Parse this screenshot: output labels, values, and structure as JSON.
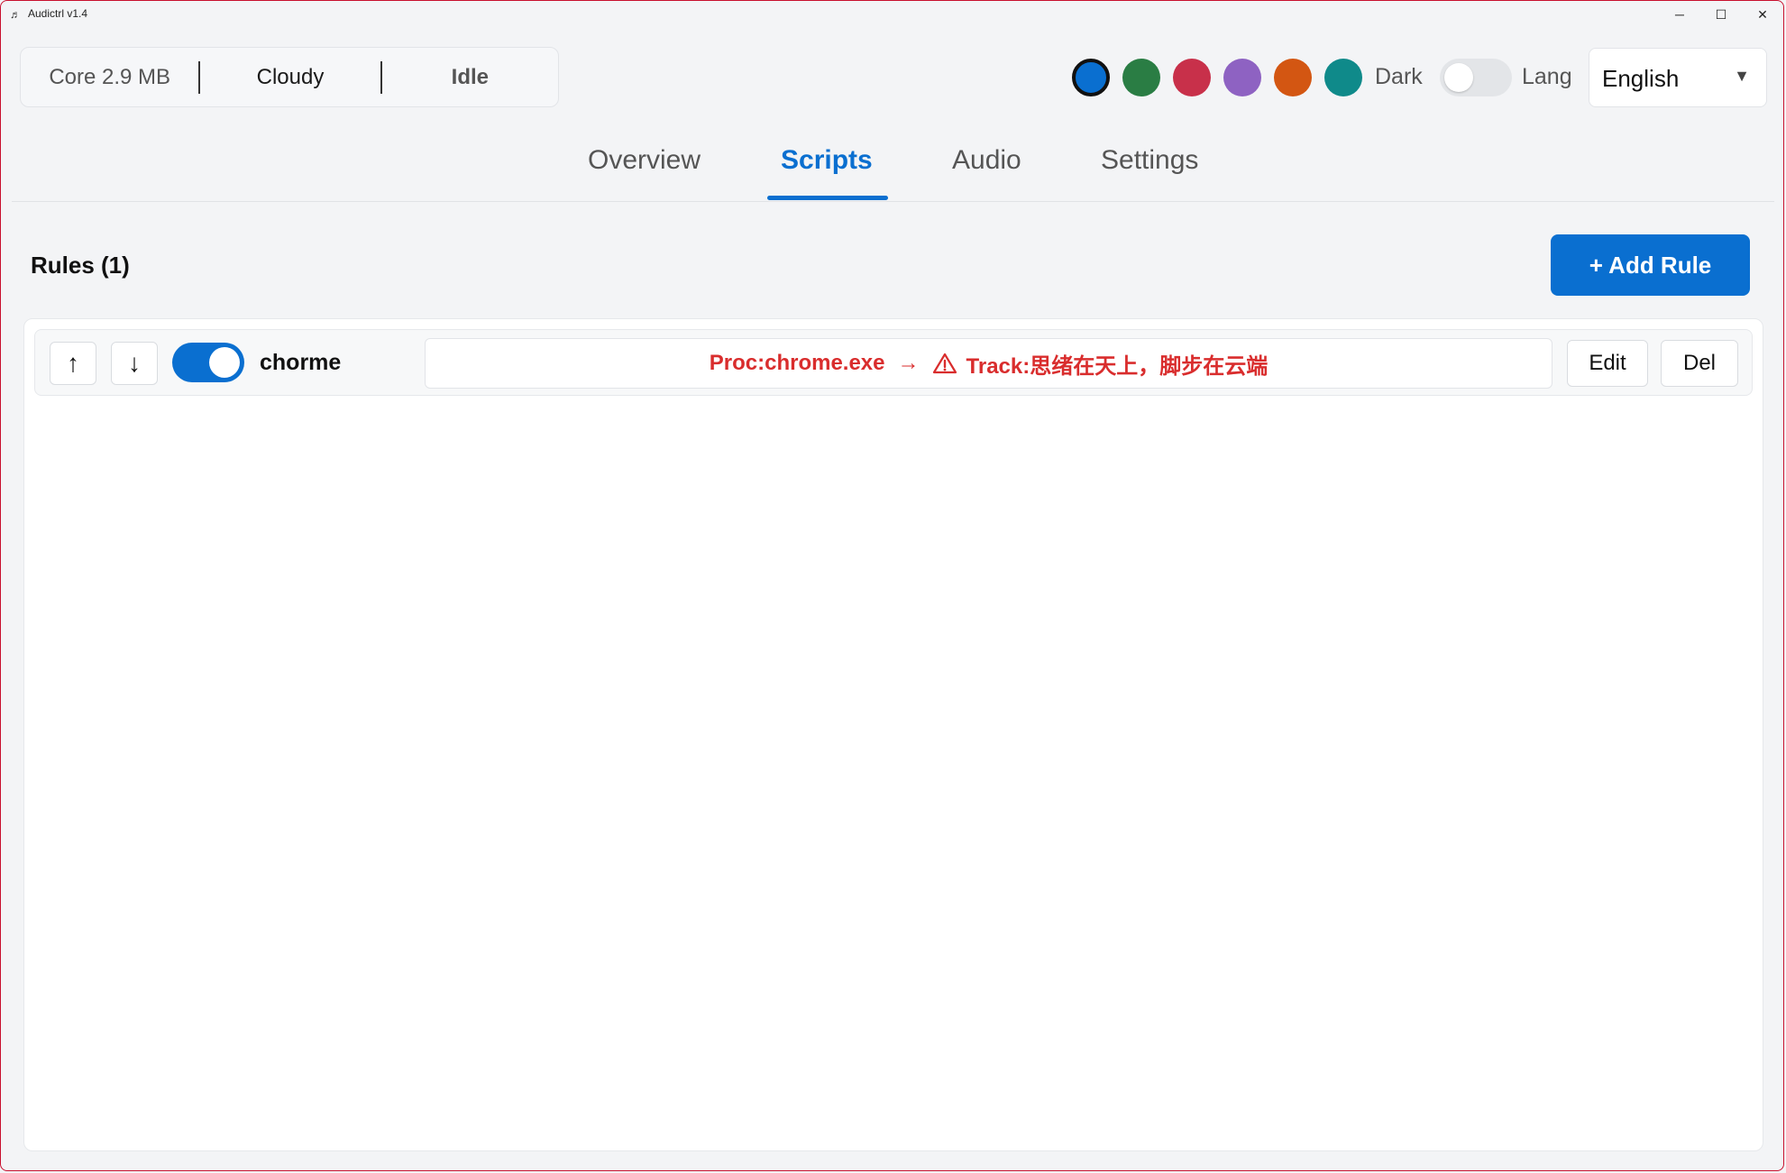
{
  "window": {
    "title": "Audictrl v1.4",
    "controls": {
      "minimize": "─",
      "maximize": "☐",
      "close": "✕"
    }
  },
  "status": {
    "core": "Core 2.9 MB",
    "weather": "Cloudy",
    "state": "Idle"
  },
  "theme": {
    "swatches": [
      {
        "name": "blue",
        "color": "#0a6fd0",
        "selected": true
      },
      {
        "name": "green",
        "color": "#2a7d44"
      },
      {
        "name": "red",
        "color": "#c8304a"
      },
      {
        "name": "purple",
        "color": "#8e62c2"
      },
      {
        "name": "orange",
        "color": "#d35612"
      },
      {
        "name": "teal",
        "color": "#0f8a8a"
      }
    ],
    "dark_label": "Dark",
    "dark_enabled": false
  },
  "language": {
    "label": "Lang",
    "selected": "English"
  },
  "tabs": [
    {
      "label": "Overview",
      "active": false
    },
    {
      "label": "Scripts",
      "active": true
    },
    {
      "label": "Audio",
      "active": false
    },
    {
      "label": "Settings",
      "active": false
    }
  ],
  "rules": {
    "title": "Rules (1)",
    "add_label": "+ Add Rule",
    "items": [
      {
        "name": "chorme",
        "enabled": true,
        "up_label": "↑",
        "down_label": "↓",
        "process": "Proc:chrome.exe",
        "arrow": "→",
        "track": "Track:思绪在天上，脚步在云端",
        "edit_label": "Edit",
        "delete_label": "Del"
      }
    ]
  },
  "colors": {
    "accent": "#0a6fd0",
    "warning_text": "#d92d2d",
    "background": "#f3f4f6"
  }
}
